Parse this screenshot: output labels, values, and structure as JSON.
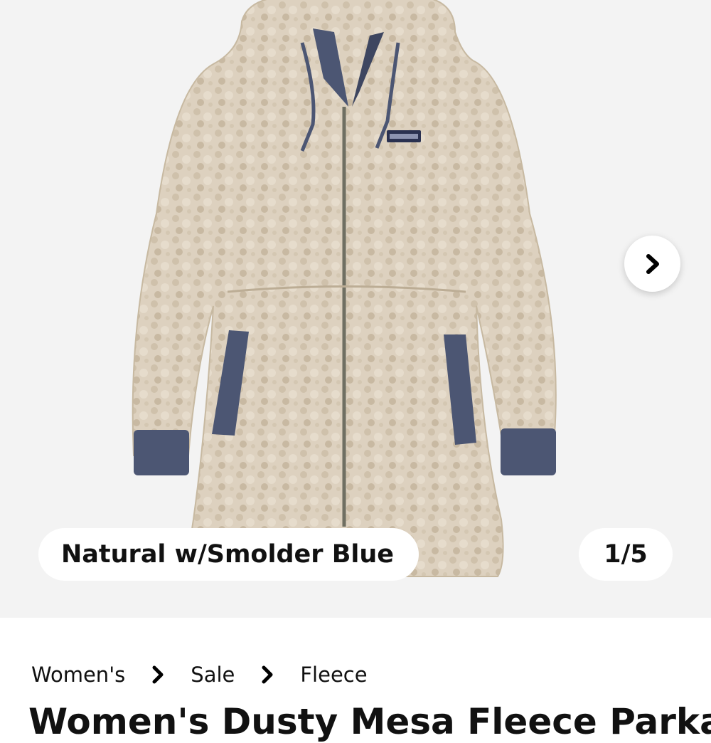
{
  "gallery": {
    "image_alt": "Women's Dusty Mesa Fleece Parka",
    "selected_color": "Natural w/Smolder Blue",
    "counter": "1/5",
    "next_icon": "chevron-right-icon",
    "colors": {
      "fleece": "#ddd1bf",
      "trim": "#4c5673",
      "background": "#f3f3f3"
    }
  },
  "breadcrumb": {
    "items": [
      "Women's",
      "Sale",
      "Fleece"
    ],
    "separator_icon": "chevron-right-icon"
  },
  "product": {
    "title": "Women's Dusty Mesa Fleece Parka"
  }
}
